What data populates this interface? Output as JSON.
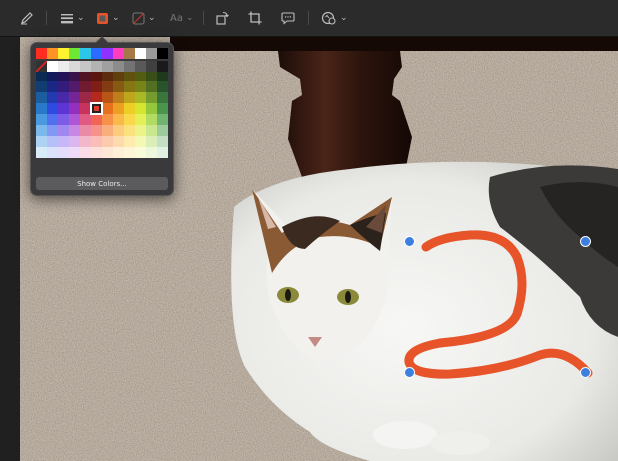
{
  "toolbar": {
    "tools": [
      {
        "name": "sketch-pen-icon"
      },
      {
        "name": "shape-style-icon"
      },
      {
        "name": "border-color-icon"
      },
      {
        "name": "fill-color-icon"
      },
      {
        "name": "text-style-icon"
      },
      {
        "name": "rotate-icon"
      },
      {
        "name": "crop-icon"
      },
      {
        "name": "annotate-icon"
      },
      {
        "name": "adjust-icon"
      }
    ],
    "text_style_label": "Aa",
    "accent_color": "#e8542a"
  },
  "palette": {
    "show_colors_label": "Show Colors...",
    "selected": {
      "row": 5,
      "col": 5
    },
    "rows": [
      [
        "#ff2d20",
        "#ff9326",
        "#fff22e",
        "#6ee835",
        "#2cc6e8",
        "#2b6bff",
        "#8f32ff",
        "#ff3dbf",
        "#a57a48",
        "#ffffff",
        "#9b9b9b",
        "#000000"
      ],
      [
        "#ff3b30",
        "#ffffff",
        "#ececec",
        "#d9d9d9",
        "#c6c6c6",
        "#b3b3b3",
        "#a0a0a0",
        "#8c8c8c",
        "#737373",
        "#595959",
        "#404040",
        "#1a1a1a"
      ],
      [
        "#0d2a52",
        "#131b5c",
        "#241357",
        "#3a124a",
        "#4f1322",
        "#5a150f",
        "#5c2a0c",
        "#5e3f0d",
        "#5e520e",
        "#545c12",
        "#3a4e17",
        "#1d3a1d"
      ],
      [
        "#123d73",
        "#1a2785",
        "#341c7d",
        "#53196a",
        "#711b31",
        "#801e15",
        "#833c11",
        "#865a12",
        "#867513",
        "#788419",
        "#536f21",
        "#29532a"
      ],
      [
        "#1b5d9e",
        "#2339b0",
        "#4a29a8",
        "#752594",
        "#9d2746",
        "#b32a1d",
        "#b85618",
        "#bd7f19",
        "#bda51c",
        "#a9b825",
        "#759c2f",
        "#3a753b"
      ],
      [
        "#2879c9",
        "#2d4be0",
        "#5d35d5",
        "#9530bd",
        "#c7335c",
        "#e0392a",
        "#e66f20",
        "#ec9f22",
        "#ecce25",
        "#d4e630",
        "#95c73d",
        "#4a954c"
      ],
      [
        "#4b9ae0",
        "#5170f0",
        "#7d5ce8",
        "#af56d6",
        "#e05b82",
        "#f26454",
        "#f79147",
        "#fab74a",
        "#fad84c",
        "#e3f058",
        "#b0dc62",
        "#6fb571"
      ],
      [
        "#7cb8ea",
        "#8199f5",
        "#a188f0",
        "#c787e2",
        "#ea8aa6",
        "#f7928a",
        "#faae7c",
        "#fccb7e",
        "#fce27f",
        "#ecf489",
        "#c9e78f",
        "#9ccc9d"
      ],
      [
        "#aed3f2",
        "#b3c1f8",
        "#c6b7f6",
        "#dcb6ee",
        "#f2b7c9",
        "#fbbdb7",
        "#fccbad",
        "#fddbae",
        "#fdecae",
        "#f3f8b5",
        "#dceeb8",
        "#c3e0c4"
      ],
      [
        "#d8ebf9",
        "#dbe2fc",
        "#e4dcfb",
        "#eedbf7",
        "#f9dce6",
        "#fddfdc",
        "#fee6d7",
        "#feefd7",
        "#fef6d7",
        "#f9fbdb",
        "#edf7dc",
        "#e1f0e2"
      ]
    ]
  },
  "drawing": {
    "stroke_color": "#e8542a",
    "handle_color": "#3b7fe0"
  }
}
